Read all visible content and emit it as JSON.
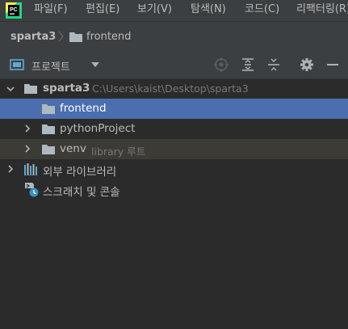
{
  "menu": {
    "items": [
      {
        "label": "파일(F)"
      },
      {
        "label": "편집(E)"
      },
      {
        "label": "보기(V)"
      },
      {
        "label": "탐색(N)"
      },
      {
        "label": "코드(C)"
      },
      {
        "label": "리팩터링(R)"
      }
    ]
  },
  "app_icon": {
    "label": "PC",
    "accent": "#21d789"
  },
  "breadcrumb": {
    "root": "sparta3",
    "leaf": "frontend"
  },
  "panel": {
    "title": "프로젝트"
  },
  "tree": {
    "root": {
      "label": "sparta3",
      "path": "C:\\Users\\kaist\\Desktop\\sparta3"
    },
    "children": [
      {
        "label": "frontend",
        "selected": true
      },
      {
        "label": "pythonProject"
      },
      {
        "label": "venv",
        "hint": "library 루트"
      }
    ],
    "external": {
      "label": "외부 라이브러리"
    },
    "scratches": {
      "label": "스크래치 및 콘솔"
    }
  },
  "colors": {
    "selection": "#4b6eaf",
    "excluded_row": "#3d3b35",
    "folder": "#aeb9c0",
    "library_bars": "#59a7d4"
  }
}
